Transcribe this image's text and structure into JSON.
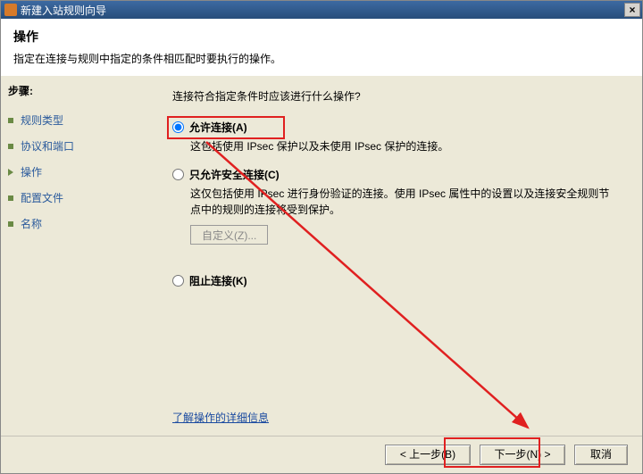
{
  "window_title": "新建入站规则向导",
  "header": {
    "title": "操作",
    "desc": "指定在连接与规则中指定的条件相匹配时要执行的操作。"
  },
  "sidebar": {
    "title": "步骤:",
    "steps": [
      {
        "label": "规则类型"
      },
      {
        "label": "协议和端口"
      },
      {
        "label": "操作"
      },
      {
        "label": "配置文件"
      },
      {
        "label": "名称"
      }
    ],
    "current_index": 2
  },
  "main": {
    "prompt": "连接符合指定条件时应该进行什么操作?",
    "options": {
      "allow": {
        "label": "允许连接(A)",
        "desc": "这包括使用 IPsec 保护以及未使用 IPsec 保护的连接。"
      },
      "allow_secure": {
        "label": "只允许安全连接(C)",
        "desc": "这仅包括使用 IPsec 进行身份验证的连接。使用 IPsec 属性中的设置以及连接安全规则节点中的规则的连接将受到保护。"
      },
      "block": {
        "label": "阻止连接(K)"
      }
    },
    "custom_button": "自定义(Z)...",
    "more_link": "了解操作的详细信息"
  },
  "buttons": {
    "back": "< 上一步(B)",
    "next": "下一步(N) >",
    "cancel": "取消"
  }
}
